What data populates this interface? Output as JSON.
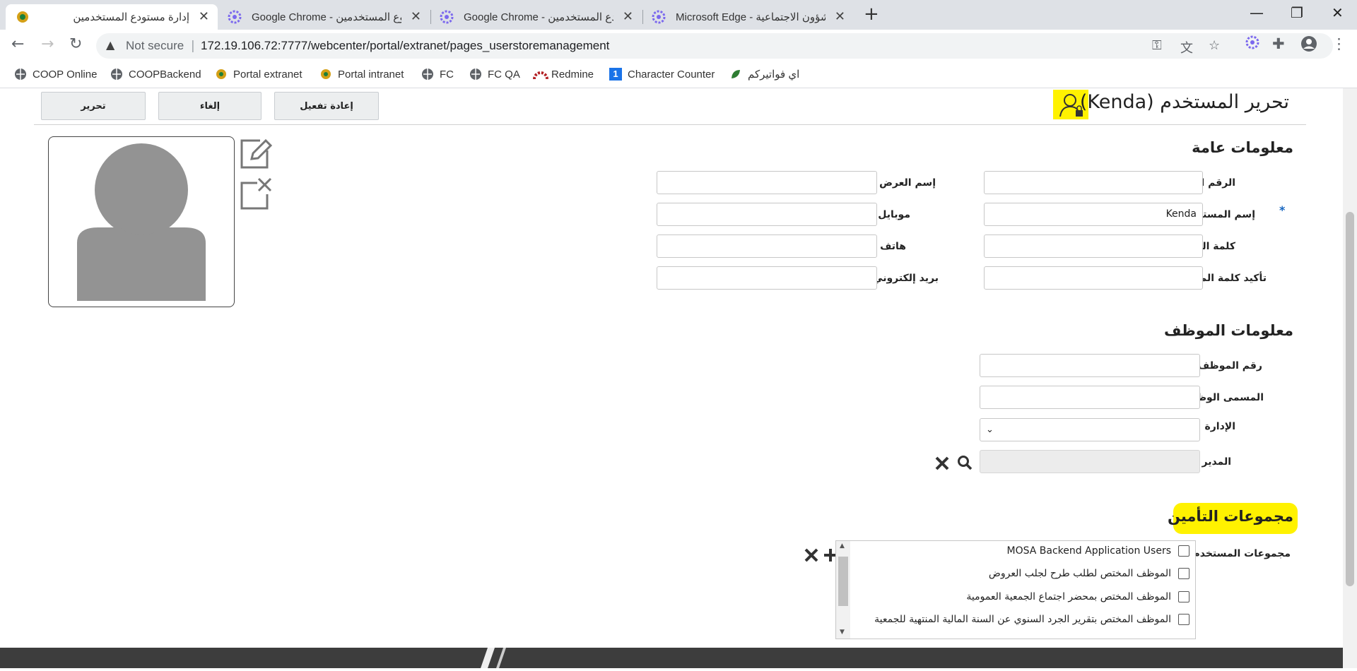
{
  "browser": {
    "tabs": [
      {
        "title": "إدارة مستودع المستخدمين",
        "active": true
      },
      {
        "title": "Google Chrome - وع المستخدمين"
      },
      {
        "title": "Google Chrome - دع المستخدمين"
      },
      {
        "title": "Microsoft Edge - شؤون الاجتماعية"
      }
    ],
    "not_secure": "Not secure",
    "url": "172.19.106.72:7777/webcenter/portal/extranet/pages_userstoremanagement",
    "bookmarks": [
      "COOP Online",
      "COOPBackend",
      "Portal extranet",
      "Portal intranet",
      "FC",
      "FC QA",
      "Redmine",
      "Character Counter",
      "اي فواتيركم"
    ],
    "accent": "#7b68ee"
  },
  "page": {
    "title": "تحرير المستخدم (Kenda)",
    "buttons": {
      "edit": "تحرير",
      "cancel": "إلغاء",
      "reactivate": "إعادة تفعيل"
    },
    "general": {
      "heading": "معلومات عامة",
      "civil_id_label": "الرقم المدني",
      "username_label": "إسم المستخدم",
      "username_value": "Kenda",
      "password_label": "كلمة المرور",
      "confirm_password_label": "تأكيد كلمة المرور",
      "display_name_label": "إسم العرض",
      "mobile_label": "موبايل",
      "phone_label": "هاتف",
      "email_label": "بريد إلكتروني"
    },
    "employee": {
      "heading": "معلومات الموظف",
      "employee_no_label": "رقم الموظف",
      "job_title_label": "المسمى الوظيفي",
      "department_label": "الإدارة",
      "manager_label": "المدير"
    },
    "security": {
      "heading": "مجموعات التأمين",
      "groups_label": "مجموعات المستخدم",
      "groups": [
        "MOSA Backend Application Users",
        "الموظف المختص لطلب طرح لجلب العروض",
        "الموظف المختص بمحضر اجتماع الجمعية العمومية",
        "الموظف المختص بتقرير الجرد السنوي عن السنة المالية المنتهية للجمعية"
      ]
    },
    "highlight_color": "#fff200"
  }
}
